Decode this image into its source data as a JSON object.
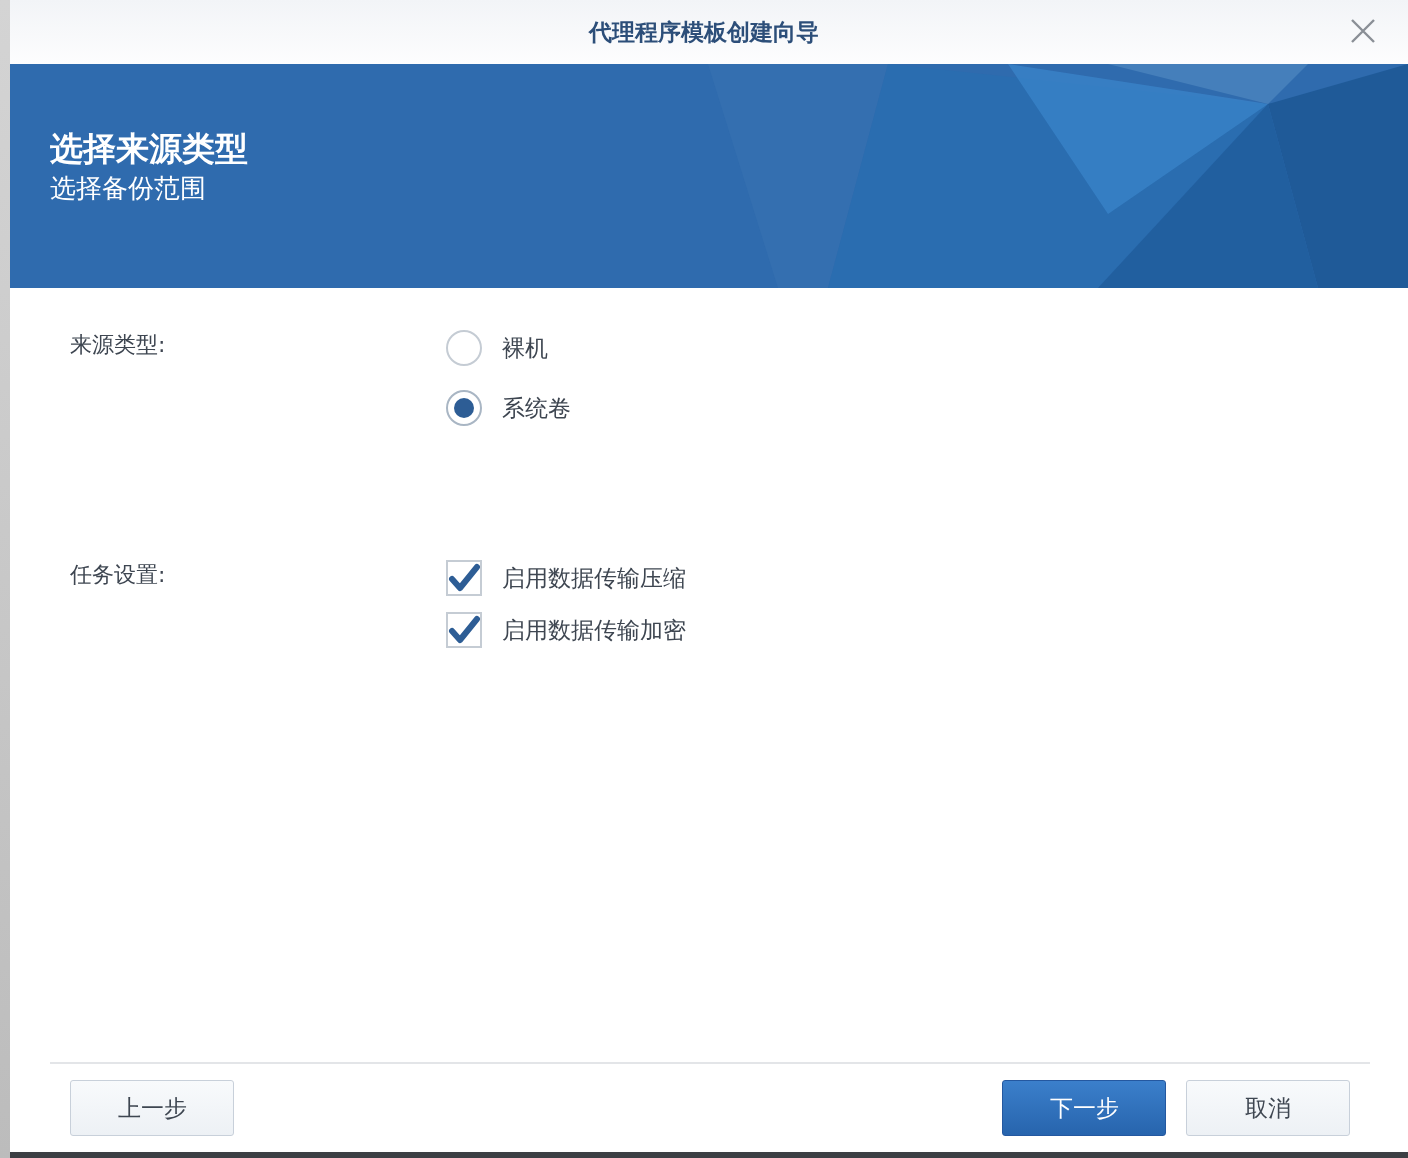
{
  "window": {
    "title": "代理程序模板创建向导"
  },
  "banner": {
    "title": "选择来源类型",
    "subtitle": "选择备份范围"
  },
  "sections": [
    {
      "label": "来源类型:",
      "kind": "radio",
      "options": [
        {
          "label": "裸机",
          "selected": false
        },
        {
          "label": "系统卷",
          "selected": true
        }
      ]
    },
    {
      "label": "任务设置:",
      "kind": "checkbox",
      "options": [
        {
          "label": "启用数据传输压缩",
          "checked": true
        },
        {
          "label": "启用数据传输加密",
          "checked": true
        }
      ]
    }
  ],
  "footer": {
    "left": [
      {
        "label": "上一步",
        "primary": false
      }
    ],
    "right": [
      {
        "label": "下一步",
        "primary": true
      },
      {
        "label": "取消",
        "primary": false
      }
    ]
  }
}
